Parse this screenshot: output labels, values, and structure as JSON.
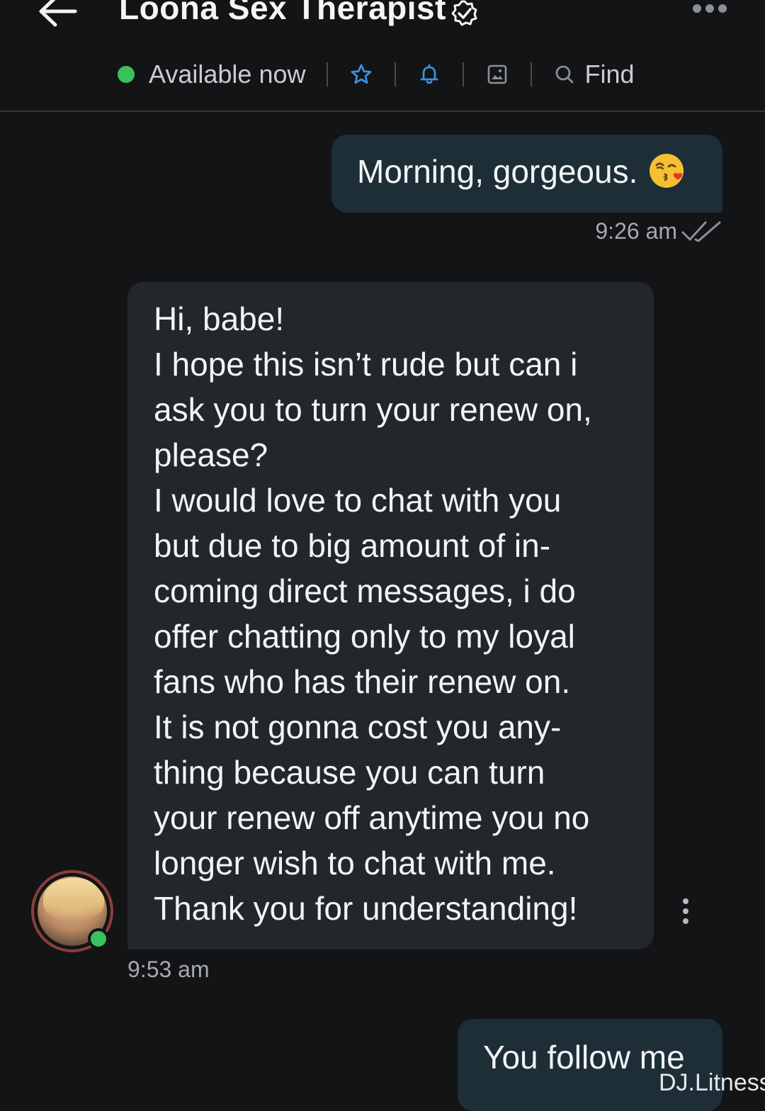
{
  "header": {
    "title": "Loona Sex Therapist",
    "status": "Available now",
    "find_label": "Find"
  },
  "messages": [
    {
      "direction": "outgoing",
      "text": "Morning, gorgeous.",
      "emoji": "kissing-face-emoji",
      "time": "9:26 am",
      "read": true
    },
    {
      "direction": "incoming",
      "lines": [
        "Hi, babe!",
        "I hope this isn’t rude but can i",
        "ask you to turn your renew on,",
        "please?",
        "I would love to chat with you",
        "but due to big amount of in-",
        "coming direct messages, i do",
        "offer chatting only to my loyal",
        "fans who has their renew on.",
        "It is not gonna cost you any-",
        "thing because you can turn",
        "your renew off anytime you no",
        "longer wish to chat with me.",
        "Thank you for understanding!"
      ],
      "time": "9:53 am"
    },
    {
      "direction": "outgoing",
      "text": "You follow me"
    }
  ],
  "watermark": "DJ.Litness",
  "colors": {
    "background": "#131416",
    "outgoing_bubble": "#1d2e37",
    "incoming_bubble": "#23272c",
    "accent_blue": "#3b8fe0",
    "online_green": "#37c25b"
  },
  "icons": [
    "back-arrow-icon",
    "verified-badge-icon",
    "more-dots-icon",
    "star-icon",
    "bell-icon",
    "gallery-icon",
    "search-icon",
    "double-check-icon",
    "kebab-menu-icon"
  ]
}
